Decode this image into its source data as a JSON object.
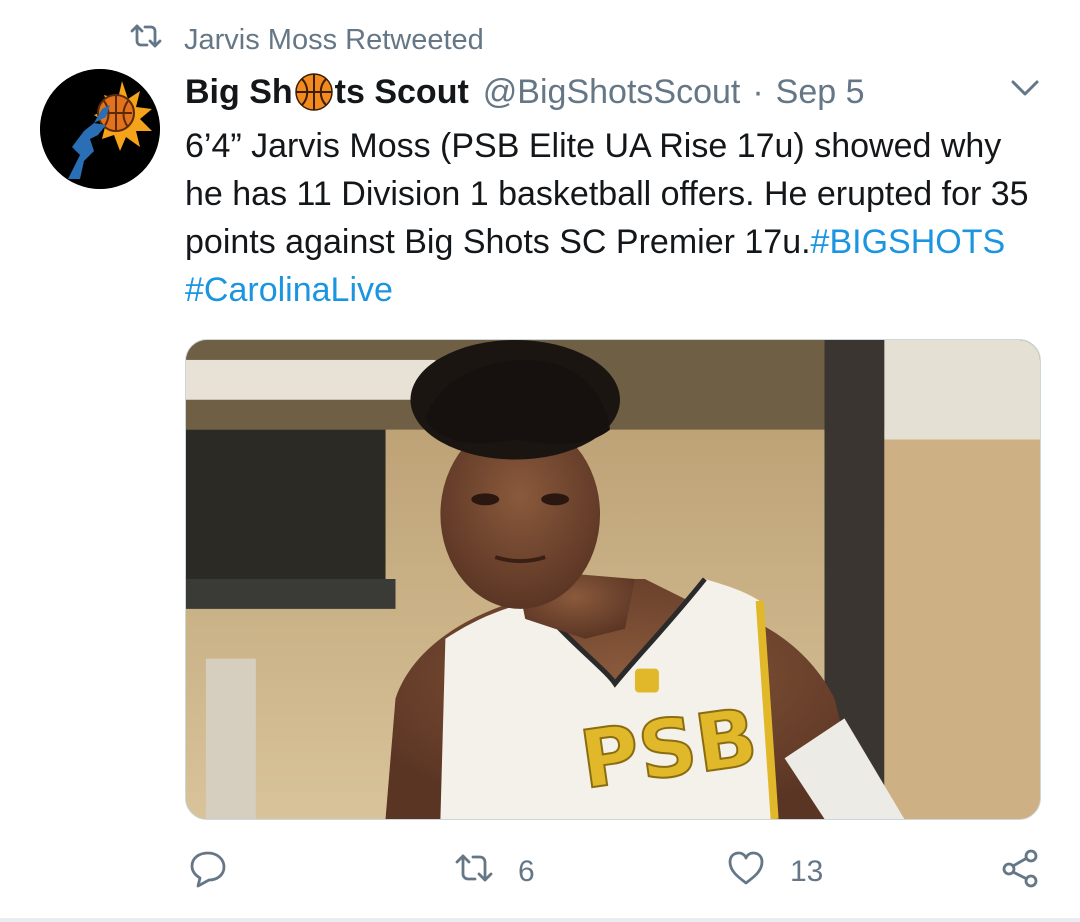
{
  "retweet_context": {
    "text": "Jarvis Moss Retweeted"
  },
  "tweet": {
    "author_name_before": "Big Sh",
    "author_name_after": "ts Scout",
    "handle": "@BigShotsScout",
    "separator": "·",
    "timestamp": "Sep 5",
    "body_text": "6’4” Jarvis Moss (PSB Elite UA Rise 17u) showed why he has 11 Division 1 basketball offers. He erupted for 35 points against Big Shots SC Premier 17u.",
    "hashtags": [
      "#BIGSHOTS",
      "#CarolinaLive"
    ],
    "image_jersey_text": "PSB"
  },
  "actions": {
    "retweet_count": "6",
    "like_count": "13"
  },
  "colors": {
    "text": "#14171a",
    "secondary": "#657786",
    "link": "#1b95e0"
  }
}
